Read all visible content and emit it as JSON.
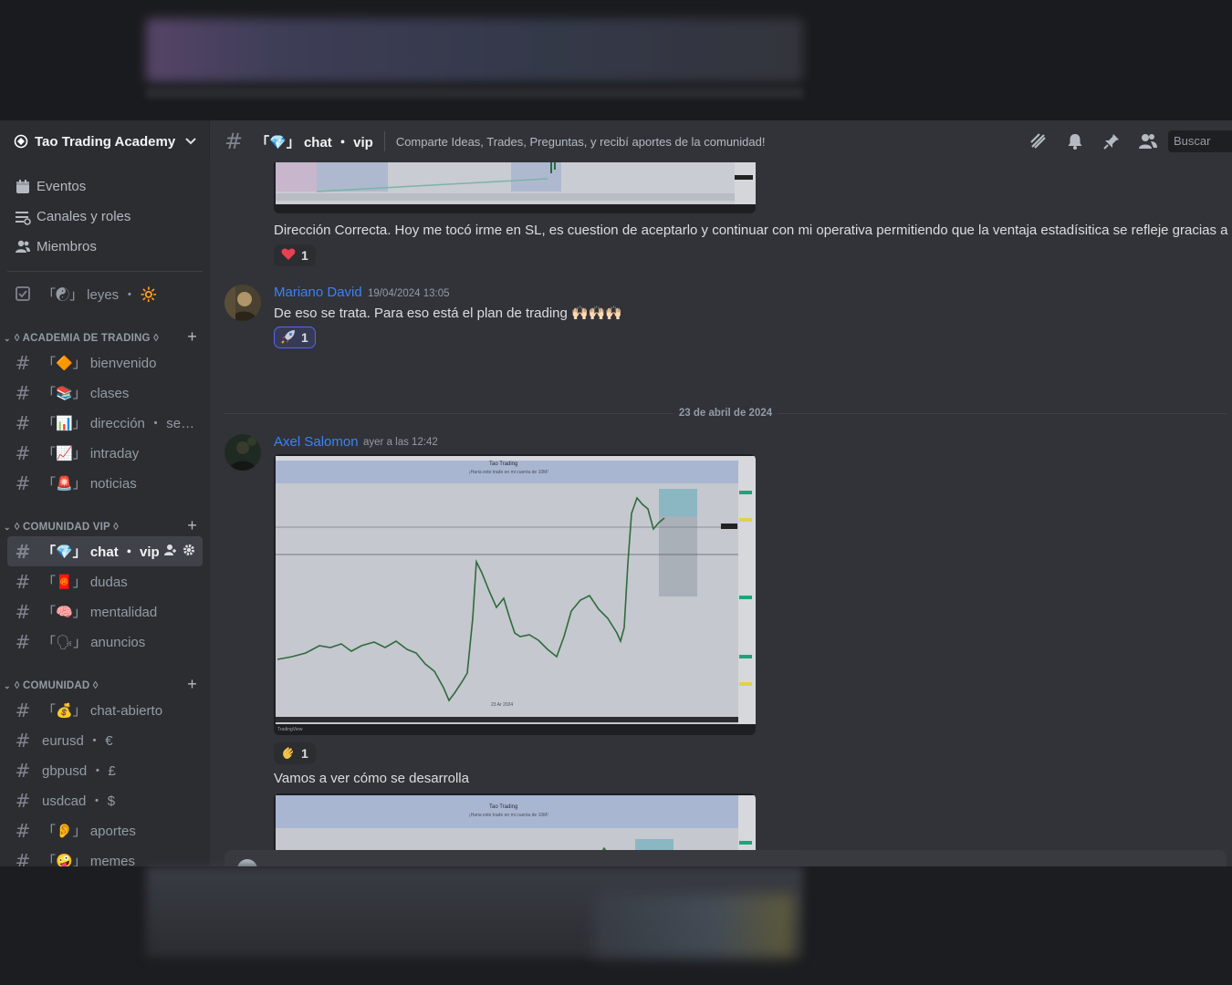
{
  "server": {
    "name": "Tao Trading Academy"
  },
  "channel_header": {
    "title": "「💎」 chat ・ vip",
    "topic": "Comparte Ideas, Trades, Preguntas, y recibí aportes de la comunidad!",
    "search_placeholder": "Buscar",
    "icons": [
      "threads-icon",
      "bell-icon",
      "pin-icon",
      "members-icon"
    ]
  },
  "sidebar": {
    "top_items": [
      {
        "label": "Eventos",
        "icon": "calendar-icon"
      },
      {
        "label": "Canales y roles",
        "icon": "list-icon"
      },
      {
        "label": "Miembros",
        "icon": "members-icon"
      }
    ],
    "rules_channel": "「☯」 leyes ・ 🔆",
    "categories": [
      {
        "name": "◊ ACADEMIA DE TRADING ◊",
        "channels": [
          "「🔶」 bienvenido",
          "「📚」 clases",
          "「📊」 dirección ・ sema...",
          "「📈」 intraday",
          "「🚨」 noticias"
        ]
      },
      {
        "name": "◊ COMUNIDAD VIP ◊",
        "channels": [
          "「💎」 chat ・ vip",
          "「🧧」 dudas",
          "「🧠」 mentalidad",
          "「🗣」 anuncios"
        ]
      },
      {
        "name": "◊ COMUNIDAD ◊",
        "channels": [
          "「💰」 chat-abierto",
          "eurusd ・ €",
          "gbpusd ・ £",
          "usdcad ・ $",
          "「👂」 aportes",
          "「🤪」 memes"
        ]
      }
    ]
  },
  "messages": {
    "m1_text": "Dirección Correcta. Hoy me tocó irme en SL, es cuestion de aceptarlo y continuar con mi operativa permitiendo que la ventaja estadísitica se refleje gracias a éso",
    "m1_reaction": {
      "emoji": "❤️",
      "count": "1"
    },
    "m2_author": "Mariano David",
    "m2_time": "19/04/2024 13:05",
    "m2_text": "De eso se trata. Para eso está el plan de trading 🙌🏻🙌🏻🙌🏻",
    "m2_reaction": {
      "emoji": "🚀",
      "count": "1"
    },
    "date_divider": "23 de abril de 2024",
    "m3_author": "Axel Salomon",
    "m3_time": "ayer a las 12:42",
    "m3_reaction": {
      "emoji": "👏",
      "count": "1"
    },
    "m3_text2": "Vamos a ver cómo se desarrolla",
    "chart_title": "Tao Trading",
    "chart_subtitle": "¡Haria este trade en mi cuenta de 10M!",
    "chart_footer": "TradingView",
    "chart_date": "23 Ar 2024"
  },
  "colors": {
    "author": "#3b82f6",
    "active_channel_bg": "#404249",
    "sidebar_bg": "#2b2d31",
    "chat_bg": "#313338"
  }
}
